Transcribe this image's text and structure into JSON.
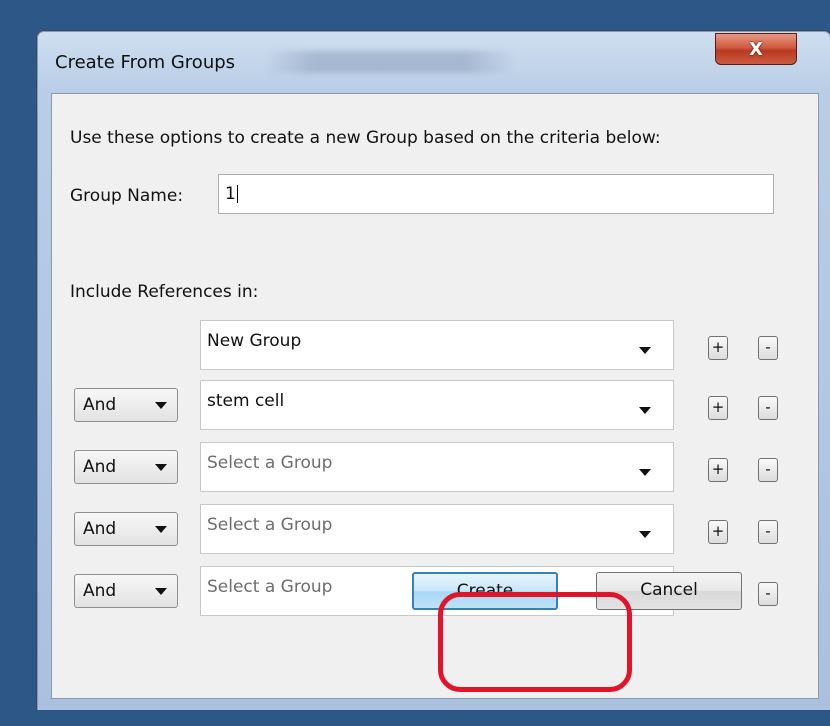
{
  "dialog": {
    "title": "Create From Groups",
    "close_label": "X",
    "instructions": "Use these options to create a new Group based on the criteria below:",
    "group_name_label": "Group Name:",
    "group_name_value": "1",
    "include_label": "Include References in:",
    "rows": [
      {
        "operator": "",
        "group": "New Group",
        "is_placeholder": false
      },
      {
        "operator": "And",
        "group": "stem cell",
        "is_placeholder": false
      },
      {
        "operator": "And",
        "group": "Select a Group",
        "is_placeholder": true
      },
      {
        "operator": "And",
        "group": "Select a Group",
        "is_placeholder": true
      },
      {
        "operator": "And",
        "group": "Select a Group",
        "is_placeholder": true
      }
    ],
    "plus_label": "+",
    "minus_label": "-",
    "create_label": "Create",
    "cancel_label": "Cancel"
  },
  "colors": {
    "desktop": "#2d5786",
    "highlight": "#e0152b",
    "close_button": "#c94a30"
  }
}
